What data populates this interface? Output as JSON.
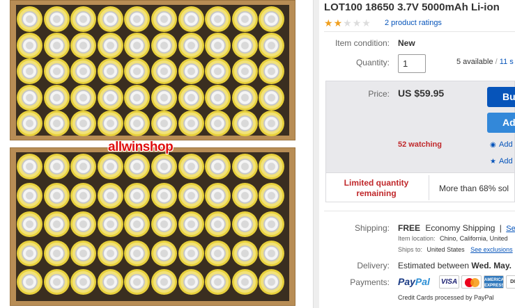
{
  "photo": {
    "watermark": "allwinshop",
    "boxes": [
      {
        "rows": 5,
        "cols": 10
      },
      {
        "rows": 5,
        "cols": 10
      }
    ]
  },
  "listing": {
    "title": "LOT100 18650 3.7V 5000mAh Li-ion",
    "rating": {
      "stars_filled": 2,
      "stars_total": 5,
      "ratings_text": "2 product ratings"
    },
    "condition": {
      "label": "Item condition:",
      "value": "New"
    },
    "quantity": {
      "label": "Quantity:",
      "value": "1",
      "available": "5 available",
      "sold_link": "11 s"
    },
    "price": {
      "label": "Price:",
      "value": "US $59.95"
    },
    "watching": "52 watching",
    "buy_button": "Bu",
    "cart_button": "Ad",
    "watch_link": "Add",
    "add_link": "Add",
    "limited": "Limited quantity remaining",
    "sold_pct": "More than 68% sol",
    "shipping": {
      "label": "Shipping:",
      "free": "FREE",
      "method": "Economy Shipping",
      "separator": "|",
      "see_link": "See",
      "item_location_label": "Item location:",
      "item_location": "Chino, California, United",
      "ships_to_label": "Ships to:",
      "ships_to": "United States",
      "exclusions_link": "See exclusions"
    },
    "delivery": {
      "label": "Delivery:",
      "text": "Estimated between",
      "date": "Wed. May."
    },
    "payments": {
      "label": "Payments:",
      "paypal_part1": "Pay",
      "paypal_part2": "Pal",
      "cards": [
        "VISA",
        "",
        "AMERICAN EXPRESS",
        "DISC"
      ],
      "note": "Credit Cards processed by PayPal"
    }
  },
  "colors": {
    "link": "#0654ba",
    "alert": "#c0282b",
    "star": "#f0a020",
    "buy_button": "#0654ba",
    "buy_box_bg": "#e9e9ec"
  }
}
